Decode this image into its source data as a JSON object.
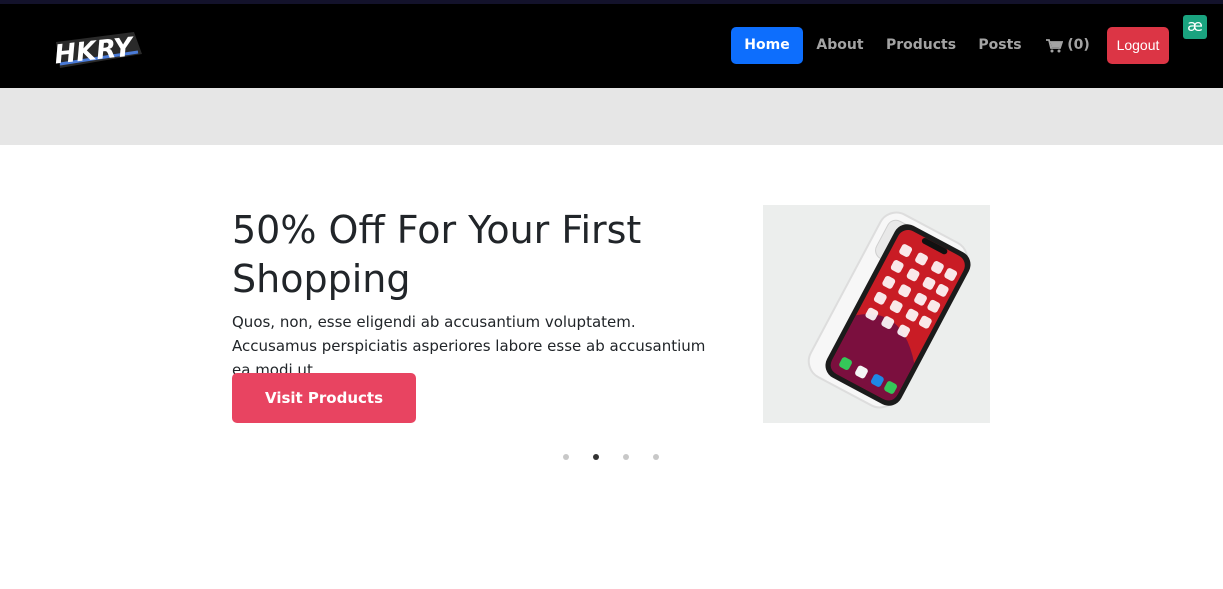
{
  "brand": {
    "logo_text": "HKRY"
  },
  "nav": {
    "home": "Home",
    "about": "About",
    "products": "Products",
    "posts": "Posts",
    "cart": "(0)",
    "logout": "Logout"
  },
  "extension_badge": "æ",
  "hero": {
    "title": "50% Off For Your First Shopping",
    "text": "Quos, non, esse eligendi ab accusantium voluptatem. Accusamus perspiciatis asperiores labore esse ab accusantium ea modi ut.",
    "button": "Visit Products"
  },
  "carousel": {
    "slides": 4,
    "active_index": 1
  },
  "colors": {
    "navbar_bg": "#000000",
    "primary": "#0d6efd",
    "danger": "#dc3545",
    "cta": "#e84461",
    "band": "#e6e6e6"
  }
}
